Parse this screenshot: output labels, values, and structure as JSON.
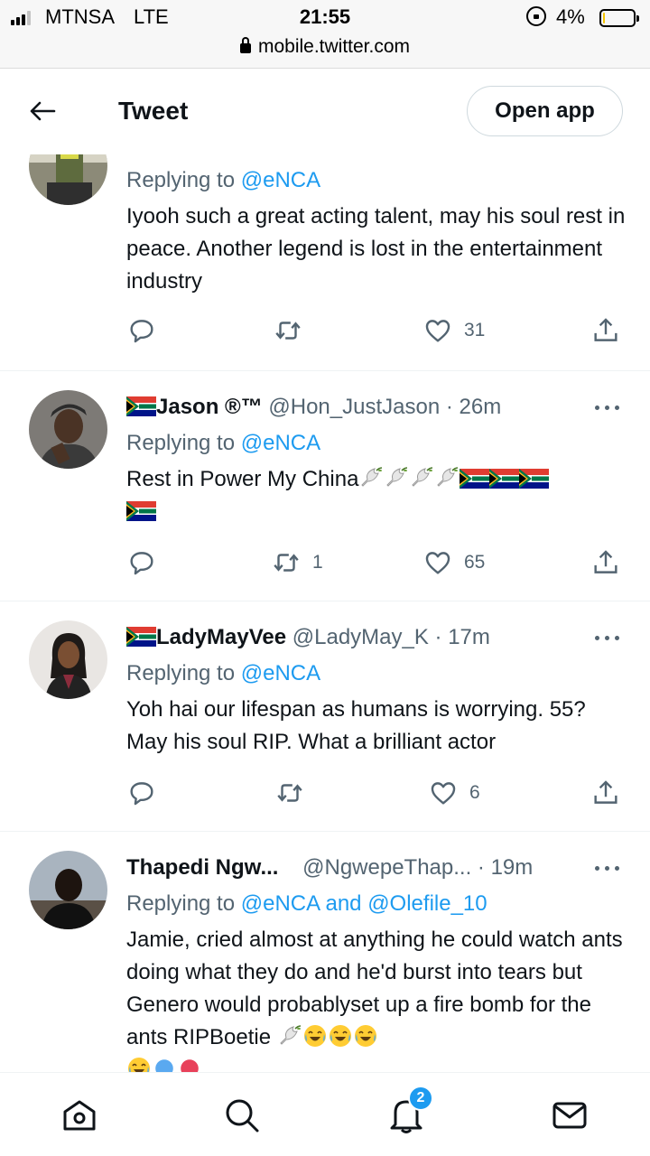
{
  "status_bar": {
    "carrier": "MTNSA",
    "network": "LTE",
    "time": "21:55",
    "battery_pct": "4%",
    "battery_level": 0.04,
    "url": "mobile.twitter.com"
  },
  "header": {
    "title": "Tweet",
    "open_app": "Open app"
  },
  "tweets": [
    {
      "display_name": "",
      "handle": "",
      "time": "",
      "replying_label": "Replying to",
      "mentions": "@eNCA",
      "text": "Iyooh such a great acting talent, may his soul rest in peace. Another legend is lost in the entertainment industry",
      "retweets": "",
      "likes": "31"
    },
    {
      "display_name": "Jason ®™",
      "handle": "@Hon_JustJason · 26m",
      "replying_label": "Replying to",
      "mentions": "@eNCA",
      "text": "Rest in Power My China",
      "retweets": "1",
      "likes": "65"
    },
    {
      "display_name": "LadyMayVee",
      "handle": "@LadyMay_K · 17m",
      "replying_label": "Replying to",
      "mentions": "@eNCA",
      "text": "Yoh hai our lifespan as humans is worrying. 55? May his soul RIP. What a brilliant actor",
      "retweets": "",
      "likes": "6"
    },
    {
      "display_name": "Thapedi Ngw...",
      "handle": "@NgwepeThap... · 19m",
      "replying_label": "Replying to",
      "mentions": "@eNCA and @Olefile_10",
      "text": "Jamie, cried almost at anything he could watch ants doing what they do and he'd burst into tears but Genero would probablyset up a fire bomb for the ants RIPBoetie",
      "retweets": "",
      "likes": ""
    }
  ],
  "bottom_nav": {
    "notifications_badge": "2"
  },
  "icons": [
    "back-arrow-icon",
    "reply-icon",
    "retweet-icon",
    "like-icon",
    "share-icon",
    "more-icon",
    "home-icon",
    "search-icon",
    "notifications-icon",
    "messages-icon",
    "sa-flag-icon",
    "dove-icon",
    "tears-of-joy-icon"
  ],
  "colors": {
    "link": "#1d9bf0",
    "text": "#0f1419",
    "secondary": "#536471",
    "divider": "#eff3f4"
  }
}
